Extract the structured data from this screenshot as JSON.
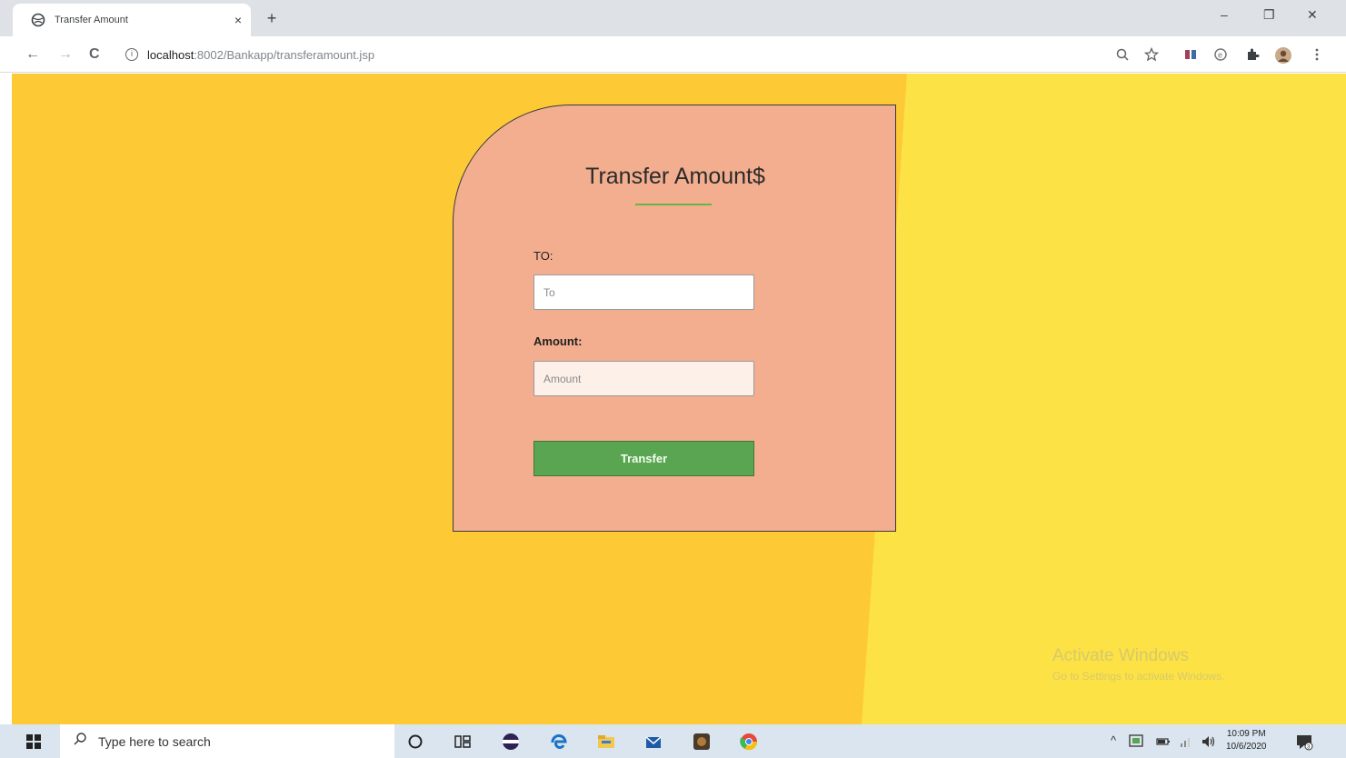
{
  "browser": {
    "tab": {
      "title": "Transfer Amount",
      "close": "×"
    },
    "new_tab": "+",
    "window_controls": {
      "minimize": "–",
      "restore": "❐",
      "close": "✕"
    },
    "nav": {
      "back": "←",
      "forward": "→",
      "reload": "C"
    },
    "address": {
      "host": "localhost",
      "path": ":8002/Bankapp/transferamount.jsp"
    }
  },
  "form": {
    "title": "Transfer Amount$",
    "to_label": "TO:",
    "to_placeholder": "To",
    "amount_label": "Amount:",
    "amount_placeholder": "Amount",
    "submit_label": "Transfer"
  },
  "watermark": {
    "title": "Activate Windows",
    "subtitle": "Go to Settings to activate Windows."
  },
  "taskbar": {
    "search_placeholder": "Type here to search",
    "time": "10:09 PM",
    "date": "10/6/2020"
  },
  "colors": {
    "page_left": "#fdc935",
    "page_right": "#fde245",
    "card": "#f2ae8f",
    "button": "#5aa552",
    "title_rule": "#66b34a"
  }
}
